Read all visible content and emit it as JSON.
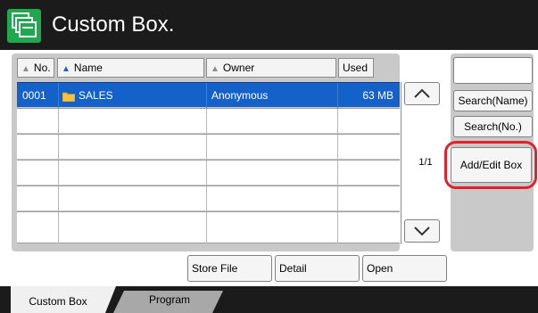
{
  "header": {
    "title": "Custom Box.",
    "logo_icon": "box-stack-icon"
  },
  "table": {
    "columns": [
      {
        "label": "No.",
        "sort_icon": "sort-triangle-icon",
        "active": false
      },
      {
        "label": "Name",
        "sort_icon": "sort-triangle-icon",
        "active": true
      },
      {
        "label": "Owner",
        "sort_icon": "sort-triangle-icon",
        "active": false
      },
      {
        "label": "Used",
        "sort_icon": "",
        "active": false
      }
    ],
    "rows": [
      {
        "no": "0001",
        "name": "SALES",
        "owner": "Anonymous",
        "used": "63 MB",
        "selected": true,
        "icon": "folder-icon"
      },
      {
        "no": "",
        "name": "",
        "owner": "",
        "used": "",
        "selected": false
      },
      {
        "no": "",
        "name": "",
        "owner": "",
        "used": "",
        "selected": false
      },
      {
        "no": "",
        "name": "",
        "owner": "",
        "used": "",
        "selected": false
      },
      {
        "no": "",
        "name": "",
        "owner": "",
        "used": "",
        "selected": false
      },
      {
        "no": "",
        "name": "",
        "owner": "",
        "used": "",
        "selected": false
      }
    ]
  },
  "pagination": {
    "page": "1/1",
    "up_icon": "chevron-up-icon",
    "down_icon": "chevron-down-icon"
  },
  "side": {
    "search_value": "",
    "search_name": "Search(Name)",
    "search_no": "Search(No.)",
    "add_edit": "Add/Edit Box"
  },
  "actions": {
    "store_file": "Store File",
    "detail": "Detail",
    "open": "Open"
  },
  "tabs": [
    {
      "label": "Custom Box",
      "active": true
    },
    {
      "label": "Program",
      "active": false
    }
  ],
  "colors": {
    "selection": "#1462c9",
    "header_bg": "#1b1b1b",
    "logo_green": "#1fa84d",
    "highlight_red": "#e2212b"
  }
}
